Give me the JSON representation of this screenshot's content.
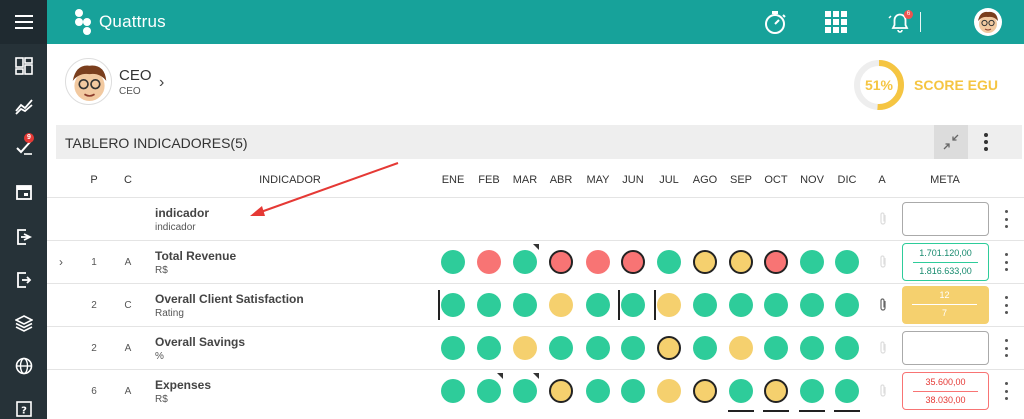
{
  "app": {
    "brand": "Quattrus"
  },
  "sidebar": {
    "items": [
      {
        "name": "dashboard",
        "icon": "dashboard-icon"
      },
      {
        "name": "trend",
        "icon": "trend-icon"
      },
      {
        "name": "tasks",
        "icon": "check-list-icon",
        "badge": "9"
      },
      {
        "name": "calendar",
        "icon": "calendar-icon"
      },
      {
        "name": "export",
        "icon": "export-icon"
      },
      {
        "name": "exit",
        "icon": "exit-icon"
      },
      {
        "name": "layers",
        "icon": "layers-icon"
      },
      {
        "name": "globe",
        "icon": "globe-icon"
      },
      {
        "name": "help",
        "icon": "help-icon"
      }
    ]
  },
  "topbar": {
    "notifications_badge": "6"
  },
  "profile": {
    "name": "CEO",
    "subtitle": "CEO"
  },
  "score": {
    "percent": "51%",
    "value": 51,
    "label": "SCORE EGU",
    "color": "#f5c542"
  },
  "panel": {
    "title": "TABLERO INDICADORES(5)"
  },
  "table": {
    "headers": {
      "p": "P",
      "c": "C",
      "indicator": "INDICADOR",
      "a": "A",
      "meta": "META"
    },
    "months": [
      "ENE",
      "FEB",
      "MAR",
      "ABR",
      "MAY",
      "JUN",
      "JUL",
      "AGO",
      "SEP",
      "OCT",
      "NOV",
      "DIC"
    ],
    "rows": [
      {
        "p": "",
        "c": "",
        "name": "indicador",
        "unit": "indicador",
        "months": [],
        "meta": {
          "type": "empty"
        }
      },
      {
        "p": "1",
        "c": "A",
        "name": "Total Revenue",
        "unit": "R$",
        "months": [
          "g",
          "r",
          "g",
          "r",
          "r",
          "r",
          "g",
          "y",
          "y",
          "r",
          "g",
          "g"
        ],
        "meta": {
          "type": "value",
          "v1": "1.701.120,00",
          "v2": "1.816.633,00",
          "color": "#2ecc9a"
        }
      },
      {
        "p": "2",
        "c": "C",
        "name": "Overall Client Satisfaction",
        "unit": "Rating",
        "months": [
          "g",
          "g",
          "g",
          "y",
          "g",
          "g",
          "y",
          "g",
          "g",
          "g",
          "g",
          "g"
        ],
        "meta": {
          "type": "filled",
          "v1": "12",
          "v2": "7",
          "color": "#f5d06e"
        }
      },
      {
        "p": "2",
        "c": "A",
        "name": "Overall Savings",
        "unit": "%",
        "months": [
          "g",
          "g",
          "y",
          "g",
          "g",
          "g",
          "y",
          "g",
          "y",
          "g",
          "g",
          "g"
        ],
        "meta": {
          "type": "empty"
        }
      },
      {
        "p": "6",
        "c": "A",
        "name": "Expenses",
        "unit": "R$",
        "months": [
          "g",
          "g",
          "g",
          "y",
          "g",
          "g",
          "y",
          "y",
          "g",
          "y",
          "g",
          "g"
        ],
        "meta": {
          "type": "value",
          "v1": "35.600,00",
          "v2": "38.030,00",
          "color": "#f87474"
        }
      }
    ]
  }
}
